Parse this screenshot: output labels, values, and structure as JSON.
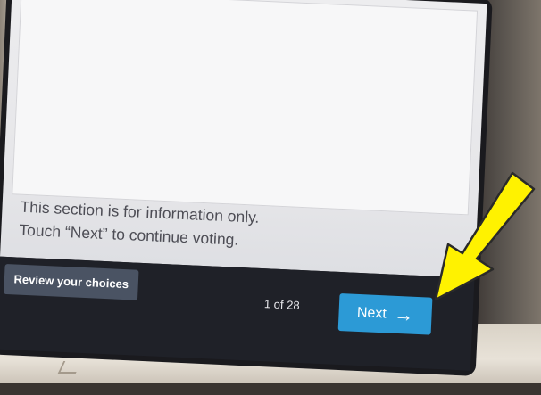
{
  "info": {
    "line1": "This section is for information only.",
    "line2": "Touch “Next” to continue voting."
  },
  "footer": {
    "review_label": "Review your choices",
    "page_count": "1 of 28",
    "next_label": "Next",
    "next_arrow": "→"
  },
  "colors": {
    "next_button": "#2c9ad6",
    "review_button": "#4a5363",
    "bottom_bar": "#1f2128",
    "annotation_arrow": "#fff200"
  }
}
